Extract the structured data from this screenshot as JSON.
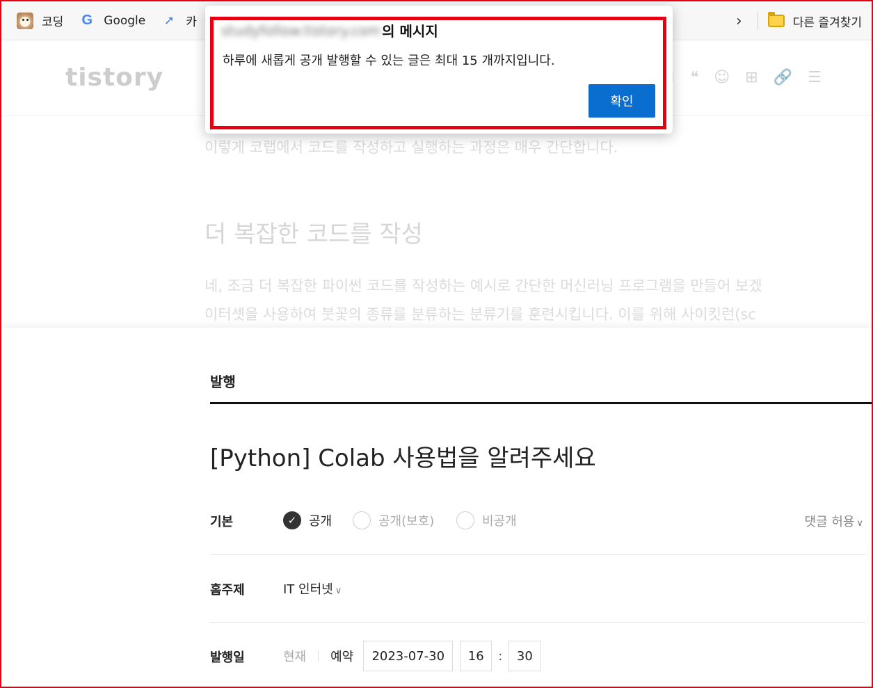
{
  "bookmarks": {
    "items": [
      {
        "label": "코딩",
        "icon": "dog-icon"
      },
      {
        "label": "Google",
        "icon": "google-icon"
      },
      {
        "label": "카",
        "icon": "rocket-icon"
      }
    ],
    "overflow_icon": "chevron-right-icon",
    "other_favorites": "다른 즐겨찾기"
  },
  "editor": {
    "logo": "tistory",
    "line1": "이렇게 코랩에서 코드를 작성하고 실행하는 과정은 매우 간단합니다.",
    "heading": "더 복잡한 코드를 작성",
    "line2": "네, 조금 더 복잡한 파이썬 코드를 작성하는 예시로 간단한 머신러닝 프로그램을 만들어 보겠",
    "line3": "이터셋을 사용하여 붓꽃의 종류를 분류하는 분류기를 훈련시킵니다. 이를 위해 사이킷런(sc"
  },
  "dialog": {
    "domain_blurred": "studyfollow.tistory.com",
    "title_suffix": "의 메시지",
    "message": "하루에 새롭게 공개 발행할 수 있는 글은 최대 15 개까지입니다.",
    "ok_label": "확인"
  },
  "publish": {
    "section_title": "발행",
    "post_title": "[Python] Colab 사용법을 알려주세요",
    "visibility": {
      "label": "기본",
      "options": [
        "공개",
        "공개(보호)",
        "비공개"
      ],
      "selected": "공개"
    },
    "comment_toggle": "댓글 허용",
    "category": {
      "label": "홈주제",
      "value": "IT 인터넷"
    },
    "date": {
      "label": "발행일",
      "now": "현재",
      "reserve": "예약",
      "date_value": "2023-07-30",
      "hour": "16",
      "minute": "30"
    }
  },
  "colors": {
    "accent": "#0a6ed1",
    "highlight": "#e60012"
  }
}
